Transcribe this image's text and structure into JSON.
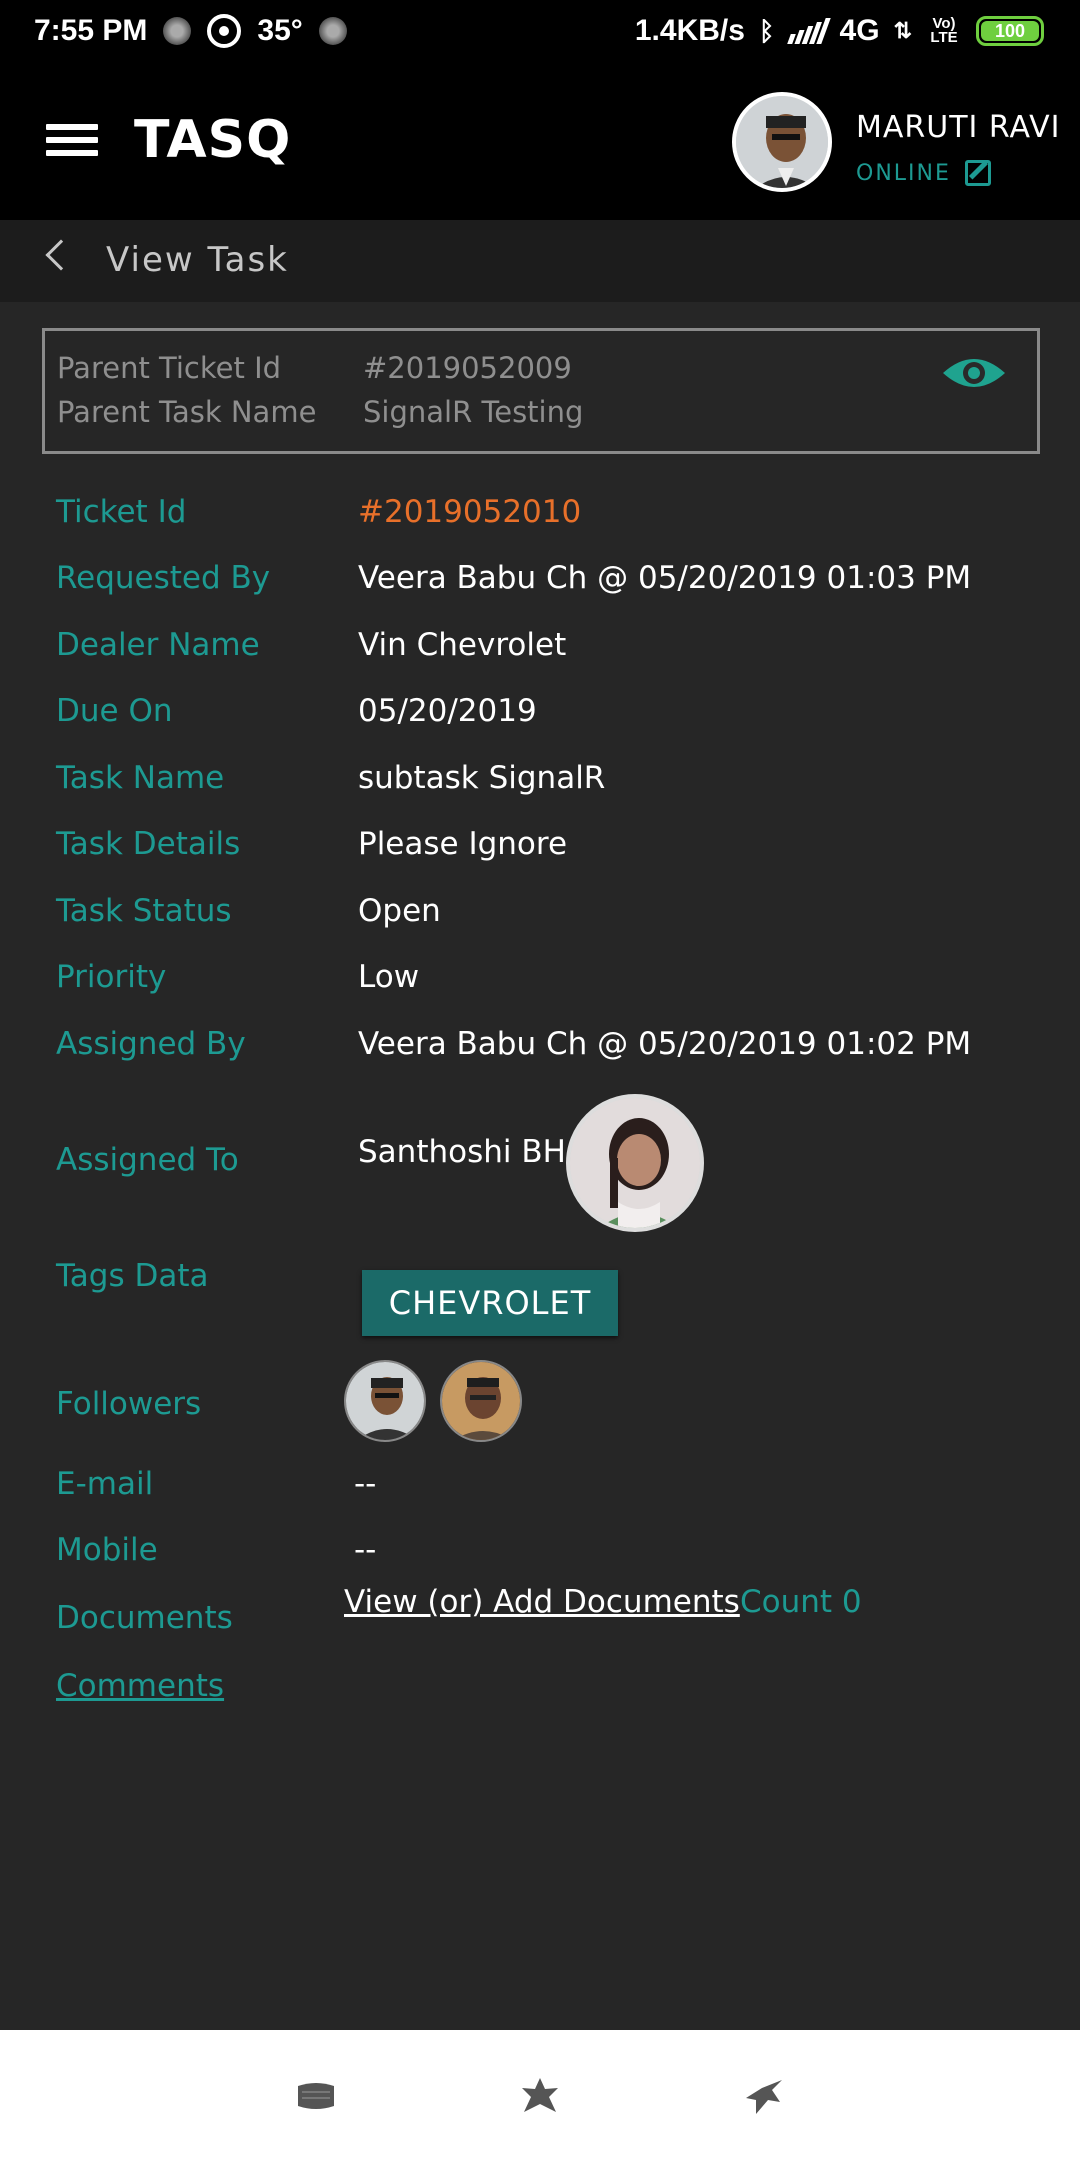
{
  "status_bar": {
    "time": "7:55 PM",
    "temperature": "35°",
    "network_speed": "1.4KB/s",
    "network_type": "4G",
    "volte_label": "Vo) LTE",
    "battery": "100"
  },
  "header": {
    "app_name": "TASQ",
    "user_name": "MARUTI RAVI",
    "user_status": "ONLINE"
  },
  "subheader": {
    "title": "View Task"
  },
  "parent": {
    "ticket_id_label": "Parent Ticket Id",
    "ticket_id_value": "#2019052009",
    "task_name_label": "Parent Task Name",
    "task_name_value": "SignalR Testing"
  },
  "details": {
    "ticket_id": {
      "label": "Ticket Id",
      "value": "#2019052010"
    },
    "requested_by": {
      "label": "Requested By",
      "value": "Veera Babu Ch @ 05/20/2019 01:03 PM"
    },
    "dealer_name": {
      "label": "Dealer Name",
      "value": "Vin Chevrolet"
    },
    "due_on": {
      "label": "Due On",
      "value": "05/20/2019"
    },
    "task_name": {
      "label": "Task Name",
      "value": "subtask SignalR"
    },
    "task_details": {
      "label": "Task Details",
      "value": "Please Ignore"
    },
    "task_status": {
      "label": "Task Status",
      "value": "Open"
    },
    "priority": {
      "label": "Priority",
      "value": "Low"
    },
    "assigned_by": {
      "label": "Assigned By",
      "value": "Veera Babu Ch @ 05/20/2019 01:02 PM"
    },
    "assigned_to": {
      "label": "Assigned To",
      "value": "Santhoshi BH"
    },
    "tags_data": {
      "label": "Tags Data",
      "value": "CHEVROLET"
    },
    "followers": {
      "label": "Followers"
    },
    "email": {
      "label": "E-mail",
      "value": "--"
    },
    "mobile": {
      "label": "Mobile",
      "value": "--"
    },
    "documents": {
      "label": "Documents",
      "link_text": "View (or) Add Documents",
      "count_text": "Count 0"
    },
    "comments": {
      "label": "Comments"
    }
  },
  "colors": {
    "accent": "#1d9a92",
    "ticket_highlight": "#e8702a",
    "tag_button": "#1b6a68",
    "background": "#262626"
  },
  "icons": {
    "menu": "hamburger-icon",
    "back": "chevron-left-icon",
    "view": "eye-icon",
    "edit": "edit-icon"
  }
}
